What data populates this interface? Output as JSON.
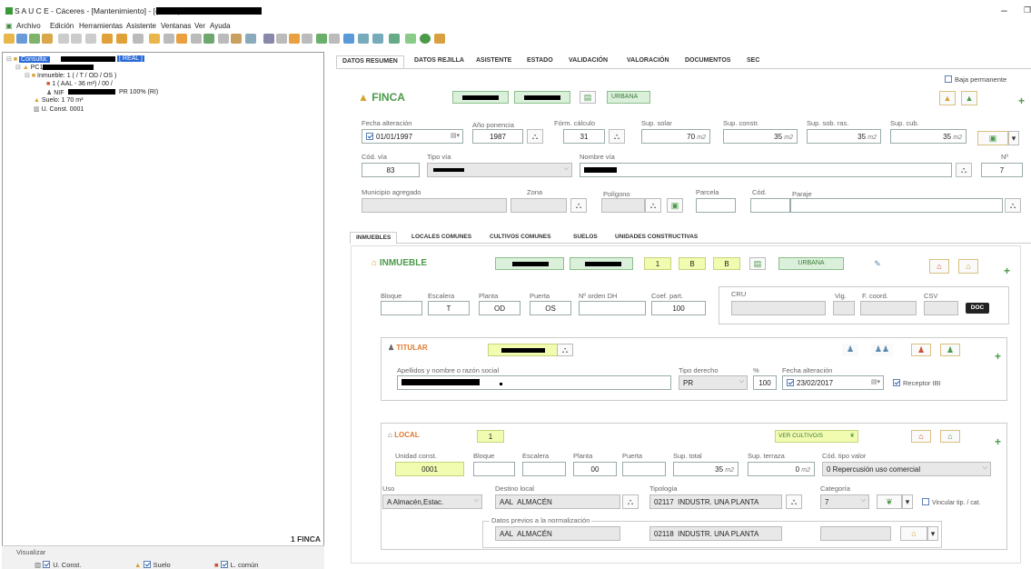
{
  "window": {
    "title": "S A U C E - Cáceres - [Mantenimiento] - [(REAL)",
    "minimize": "–",
    "restore": "❐"
  },
  "menu": [
    "Archivo",
    "Edición",
    "Herramientas",
    "Asistente",
    "Ventanas",
    "Ver",
    "Ayuda"
  ],
  "tree": {
    "consulta": "Consulta:",
    "real": "[ REAL ]",
    "pc1": "PC1",
    "inmueble": "Inmueble:  1 (   / T / OD / OS )",
    "aal": "1 ( AAL -  36 m²)    / 00 /",
    "nif": "NIF",
    "nif_rest": "PR  100%  (RI)",
    "suelo": "Suelo:  1        70 m²",
    "uconst": "U. Const. 0001",
    "count": "1 FINCA"
  },
  "visualizar": {
    "label": "Visualizar",
    "items": [
      "U. Const.",
      "Suelo",
      "L. común"
    ]
  },
  "main_tabs": [
    "DATOS RESUMEN",
    "DATOS REJILLA",
    "ASISTENTE",
    "ESTADO",
    "VALIDACIÓN",
    "VALORACIÓN",
    "DOCUMENTOS",
    "SEC"
  ],
  "baja": "Baja permanente",
  "finca": {
    "title": "FINCA",
    "tipo": "URBANA",
    "labels": {
      "fecha": "Fecha alteración",
      "ano": "Año ponencia",
      "form": "Fórm. cálculo",
      "solar": "Sup. solar",
      "constr": "Sup. constr.",
      "sobras": "Sup. sob. ras.",
      "cub": "Sup. cub.",
      "codvia": "Cód. vía",
      "tipovia": "Tipo vía",
      "nombrevia": "Nombre vía",
      "num": "Nº",
      "municipio": "Municipio agregado",
      "zona": "Zona",
      "poligono": "Polígono",
      "parcela": "Parcela",
      "cod": "Cód.",
      "paraje": "Paraje"
    },
    "values": {
      "fecha": "01/01/1997",
      "ano": "1987",
      "form": "31",
      "solar": "70",
      "constr": "35",
      "sobras": "35",
      "cub": "35",
      "codvia": "83",
      "num": "7",
      "unit": "m2"
    }
  },
  "sub_tabs": [
    "INMUEBLES",
    "LOCALES COMUNES",
    "CULTIVOS COMUNES",
    "SUELOS",
    "UNIDADES CONSTRUCTIVAS"
  ],
  "inmueble": {
    "title": "INMUEBLE",
    "v1": "1",
    "v2": "B",
    "v3": "B",
    "tipo": "URBANA",
    "labels": {
      "bloque": "Bloque",
      "escalera": "Escalera",
      "planta": "Planta",
      "puerta": "Puerta",
      "orden": "Nº orden DH",
      "coef": "Coef. part.",
      "cru": "CRU",
      "vig": "Vig.",
      "fcoord": "F. coord.",
      "csv": "CSV"
    },
    "values": {
      "escalera": "T",
      "planta": "OD",
      "puerta": "OS",
      "coef": "100",
      "doc": "DOC"
    }
  },
  "titular": {
    "title": "TITULAR",
    "labels": {
      "apellidos": "Apellidos y nombre o razón social",
      "tipo": "Tipo derecho",
      "pct": "%",
      "fecha": "Fecha alteración"
    },
    "values": {
      "tipo": "PR",
      "pct": "100",
      "fecha": "23/02/2017",
      "receptor": "Receptor IBI"
    }
  },
  "local": {
    "title": "LOCAL",
    "num": "1",
    "ver": "VER CULTIVO/S",
    "labels": {
      "unidad": "Unidad const.",
      "bloque": "Bloque",
      "escalera": "Escalera",
      "planta": "Planta",
      "puerta": "Puerta",
      "total": "Sup. total",
      "terraza": "Sup. terraza",
      "codtipo": "Cód. tipo valor",
      "uso": "Uso",
      "destino": "Destino local",
      "tipologia": "Tipología",
      "categoria": "Categoría",
      "previos": "Datos previos a la normalización"
    },
    "values": {
      "unidad": "0001",
      "planta": "00",
      "total": "35",
      "terraza": "0",
      "codtipo": "0 Repercusión uso comercial",
      "uso": "A Almacén,Estac.",
      "destino_cod": "AAL",
      "destino": "ALMACÉN",
      "tip_cod": "02117",
      "tip": "INDUSTR. UNA PLANTA",
      "categoria": "7",
      "vincular": "Vincular tip. / cat.",
      "prev_cod": "AAL",
      "prev": "ALMACÉN",
      "prev_tip_cod": "02118",
      "prev_tip": "INDUSTR. UNA PLANTA",
      "unit": "m2"
    }
  }
}
